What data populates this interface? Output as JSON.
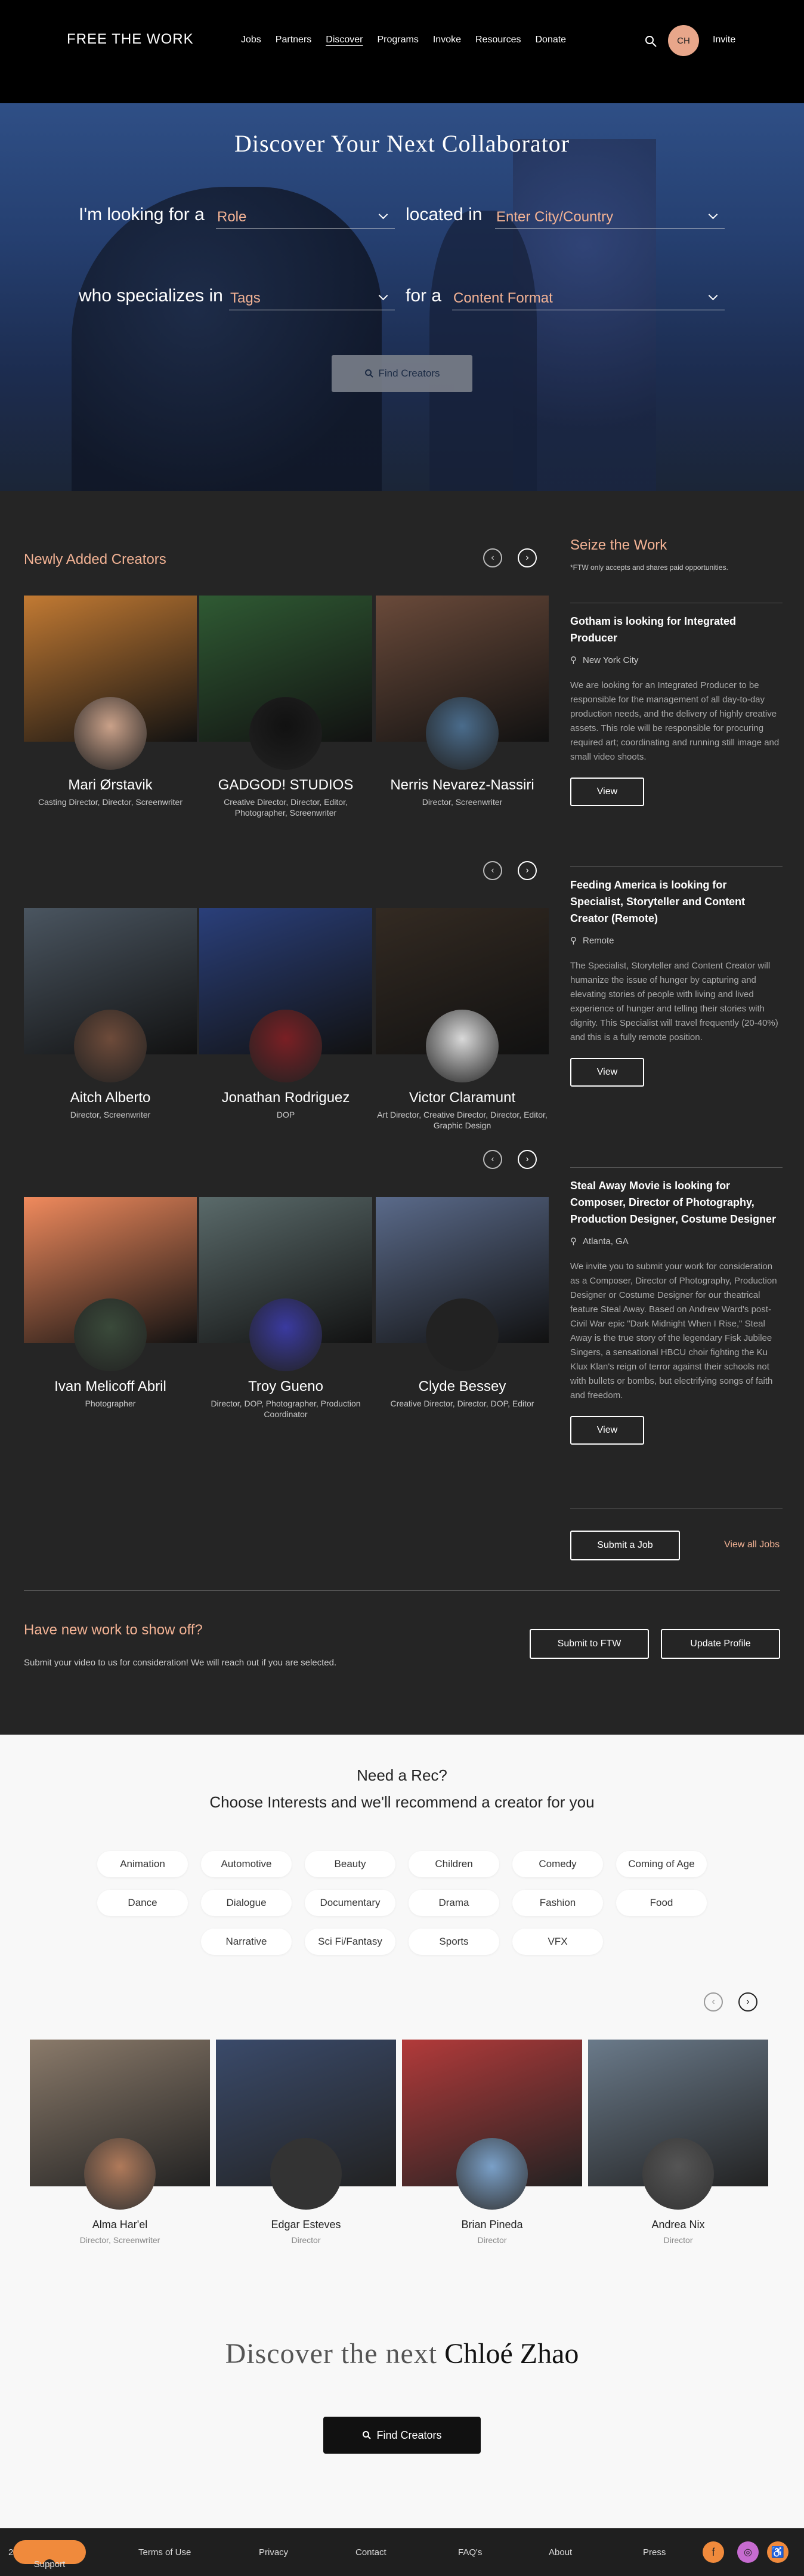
{
  "header": {
    "logo": "FREE THE WORK",
    "nav": [
      "Jobs",
      "Partners",
      "Discover",
      "Programs",
      "Invoke",
      "Resources",
      "Donate"
    ],
    "avatar_initials": "CH",
    "invite": "Invite"
  },
  "hero": {
    "title": "Discover Your Next Collaborator",
    "looking_for": "I'm looking for a",
    "role_placeholder": "Role",
    "located_in": "located in",
    "city_placeholder": "Enter City/Country",
    "specializes": "who specializes in",
    "tags_placeholder": "Tags",
    "for_a": "for a",
    "format_placeholder": "Content Format",
    "find_button": "Find Creators"
  },
  "newly_added": {
    "title": "Newly Added Creators",
    "rows": [
      [
        {
          "name": "Mari Ørstavik",
          "roles": "Casting Director, Director, Screenwriter",
          "bg": "#c27a33",
          "av": "#caa189"
        },
        {
          "name": "GADGOD! STUDIOS",
          "roles": "Creative Director, Director, Editor, Photographer, Screenwriter",
          "bg": "#2f5a33",
          "av": "#111"
        },
        {
          "name": "Nerris Nevarez-Nassiri",
          "roles": "Director, Screenwriter",
          "bg": "#6a4a3a",
          "av": "#4a6c8c"
        }
      ],
      [
        {
          "name": "Aitch Alberto",
          "roles": "Director, Screenwriter",
          "bg": "#4a5560",
          "av": "#6e4b3a"
        },
        {
          "name": "Jonathan Rodriguez",
          "roles": "DOP",
          "bg": "#2a3f7a",
          "av": "#7a1f24"
        },
        {
          "name": "Victor Claramunt",
          "roles": "Art Director, Creative Director, Director, Editor, Graphic Design",
          "bg": "#332a22",
          "av": "#d9d9d9"
        }
      ],
      [
        {
          "name": "Ivan Melicoff Abril",
          "roles": "Photographer",
          "bg": "#f08a5d",
          "av": "#3a4a3a"
        },
        {
          "name": "Troy Gueno",
          "roles": "Director, DOP, Photographer, Production Coordinator",
          "bg": "#5a6a6a",
          "av": "#3a3aa0"
        },
        {
          "name": "Clyde Bessey",
          "roles": "Creative Director, Director, DOP, Editor",
          "bg": "#5a6a8a",
          "av": "#222"
        }
      ]
    ]
  },
  "jobs": {
    "title": "Seize the Work",
    "note": "*FTW only accepts and shares paid opportunities.",
    "items": [
      {
        "title": "Gotham is looking for Integrated Producer",
        "location": "New York City",
        "desc": "We are looking for an Integrated Producer to be responsible for the management of all day-to-day production needs, and the delivery of highly creative assets. This role will be responsible for procuring required art; coordinating and running still image and small video shoots.",
        "view": "View"
      },
      {
        "title": "Feeding America is looking for Specialist, Storyteller and Content Creator (Remote)",
        "location": "Remote",
        "desc": "The Specialist, Storyteller and Content Creator will humanize the issue of hunger by capturing and elevating stories of people with living and lived experience of hunger and telling their stories with dignity. This Specialist will travel frequently (20-40%) and this is a fully remote position.",
        "view": "View"
      },
      {
        "title": "Steal Away Movie is looking for Composer, Director of Photography, Production Designer, Costume Designer",
        "location": "Atlanta, GA",
        "desc": "We invite you to submit your work for consideration as a Composer, Director of Photography, Production Designer or Costume Designer for our theatrical feature Steal Away. Based on Andrew Ward's post-Civil War epic \"Dark Midnight When I Rise,\" Steal Away is the true story of the legendary Fisk Jubilee Singers, a sensational HBCU choir fighting the Ku Klux Klan's reign of terror against their schools not with bullets or bombs, but electrifying songs of faith and freedom.",
        "view": "View"
      }
    ],
    "submit": "Submit a Job",
    "view_all": "View all Jobs"
  },
  "show_off": {
    "title": "Have new work to show off?",
    "desc": "Submit your video to us for consideration! We will reach out if you are selected.",
    "submit": "Submit to FTW",
    "update": "Update Profile"
  },
  "rec": {
    "title1": "Need a Rec?",
    "title2": "Choose Interests and we'll recommend a creator for you",
    "tags": [
      "Animation",
      "Automotive",
      "Beauty",
      "Children",
      "Comedy",
      "Coming of Age",
      "Dance",
      "Dialogue",
      "Documentary",
      "Drama",
      "Fashion",
      "Food",
      "Narrative",
      "Sci Fi/Fantasy",
      "Sports",
      "VFX"
    ],
    "creators": [
      {
        "name": "Alma Har'el",
        "roles": "Director, Screenwriter",
        "bg": "#8a7a6a",
        "av": "#b07a5a"
      },
      {
        "name": "Edgar Esteves",
        "roles": "Director",
        "bg": "#3a4a6a",
        "av": "#333"
      },
      {
        "name": "Brian Pineda",
        "roles": "Director",
        "bg": "#b23a3a",
        "av": "#7aa0c8"
      },
      {
        "name": "Andrea Nix",
        "roles": "Director",
        "bg": "#6a7a8a",
        "av": "#555"
      }
    ]
  },
  "discover_next": {
    "prefix": "Discover the next",
    "name": "Chloé Zhao",
    "button": "Find Creators"
  },
  "footer": {
    "support": "Support",
    "brand": "2",
    "links": [
      "Terms of Use",
      "Privacy",
      "Contact",
      "FAQ's",
      "About",
      "Press"
    ]
  }
}
